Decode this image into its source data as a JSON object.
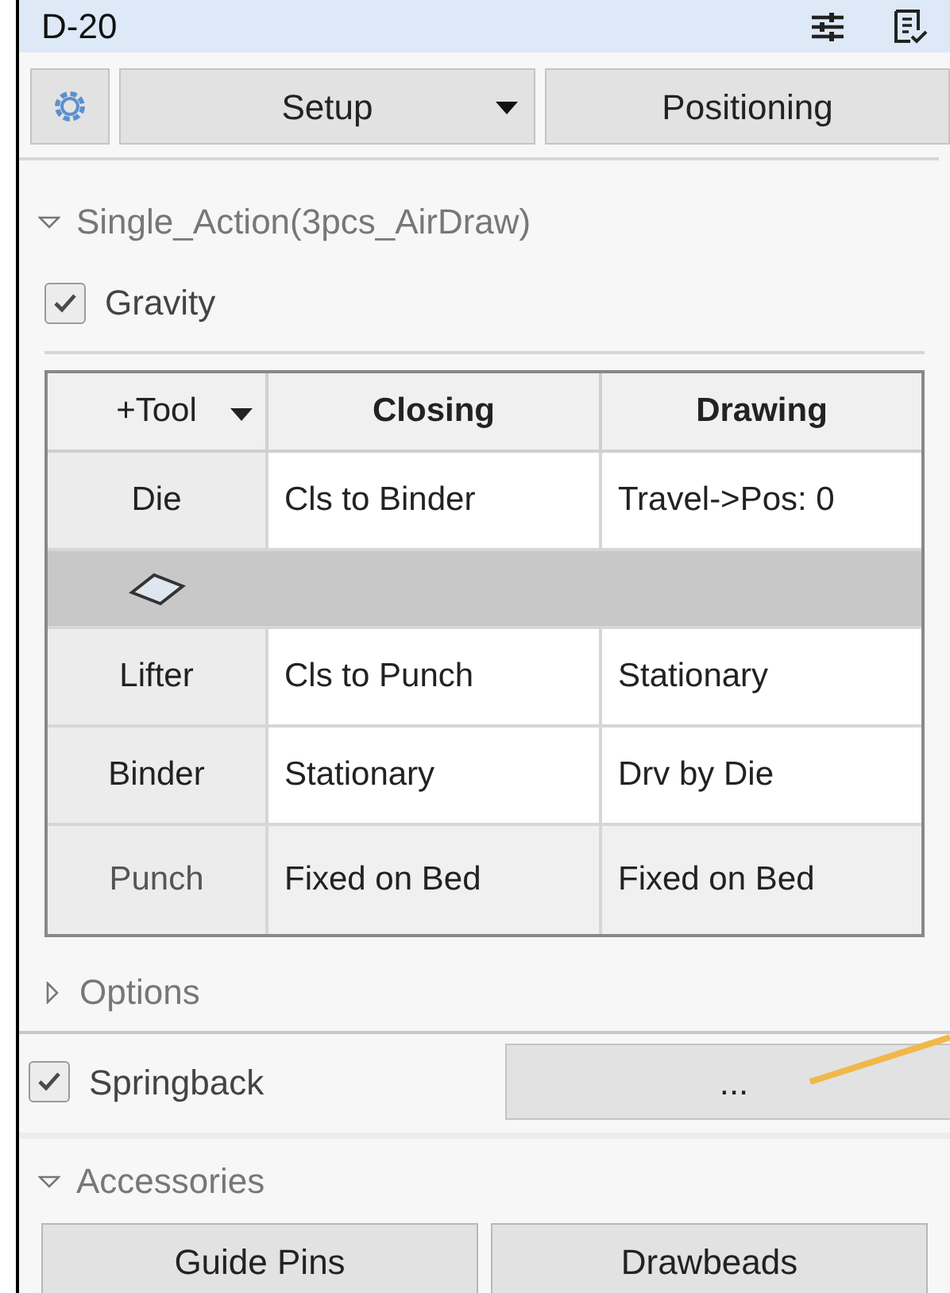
{
  "window": {
    "title": "D-20"
  },
  "toolbar": {
    "setup": "Setup",
    "positioning": "Positioning"
  },
  "sections": [
    {
      "kind": "group",
      "title": "Single_Action(3pcs_AirDraw)",
      "expanded": true
    },
    {
      "kind": "check",
      "label": "Gravity",
      "checked": true
    }
  ],
  "table": {
    "columns": [
      "+Tool",
      "Closing",
      "Drawing"
    ],
    "rows": [
      {
        "kind": "tool",
        "cells": [
          "Die",
          "Cls to Binder",
          "Travel->Pos: 0"
        ],
        "selected": false,
        "disabled": false
      },
      {
        "kind": "new",
        "cells": [],
        "selected": true,
        "disabled": false
      },
      {
        "kind": "tool",
        "cells": [
          "Lifter",
          "Cls to Punch",
          "Stationary"
        ],
        "selected": false,
        "disabled": false
      },
      {
        "kind": "tool",
        "cells": [
          "Binder",
          "Stationary",
          "Drv by Die"
        ],
        "selected": false,
        "disabled": false
      },
      {
        "kind": "tool",
        "cells": [
          "Punch",
          "Fixed on Bed",
          "Fixed on Bed"
        ],
        "selected": false,
        "disabled": true
      }
    ]
  },
  "options": {
    "title": "Options",
    "expanded": false
  },
  "springback": {
    "label": "Springback",
    "checked": true,
    "button": "..."
  },
  "accessories": {
    "title": "Accessories",
    "expanded": true,
    "buttons": [
      "Guide Pins",
      "Drawbeads"
    ]
  }
}
